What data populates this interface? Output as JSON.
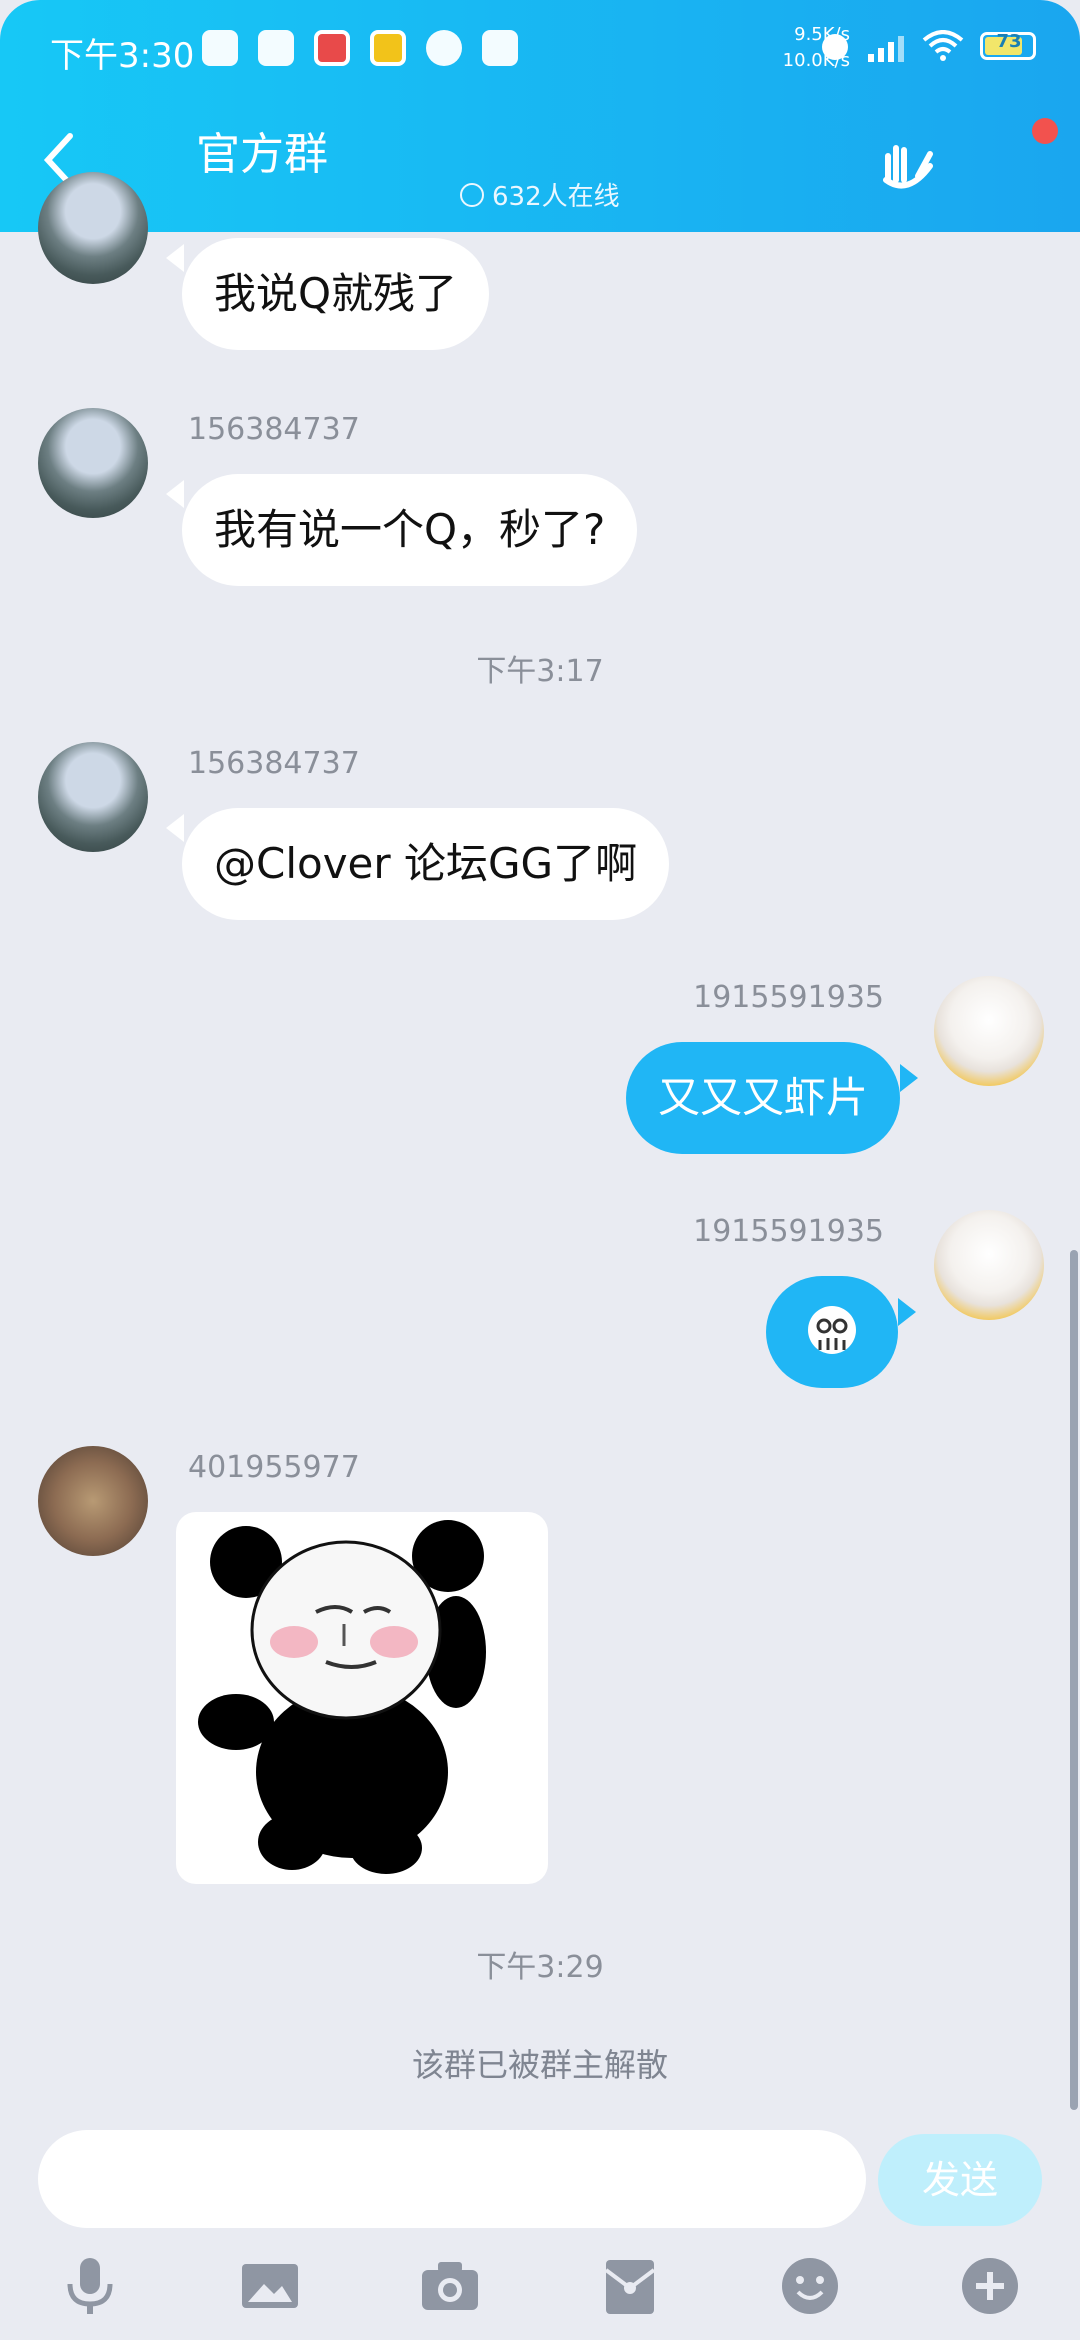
{
  "status_bar": {
    "time": "下午3:30",
    "net_speed_up": "9.5K/s",
    "net_speed_down": "10.0K/s",
    "battery": "73"
  },
  "header": {
    "title": "官方群",
    "online": "632人在线"
  },
  "messages": [
    {
      "sender": "",
      "text": "我说Q就残了"
    },
    {
      "sender": "156384737",
      "text": "我有说一个Q，秒了?"
    },
    {
      "time": "下午3:17"
    },
    {
      "sender": "156384737",
      "text": "@Clover 论坛GG了啊"
    },
    {
      "sender": "1915591935",
      "text": "又又又虾片"
    },
    {
      "sender": "1915591935",
      "text": ""
    },
    {
      "sender": "401955977",
      "text": ""
    },
    {
      "time": "下午3:29"
    },
    {
      "system": "该群已被群主解散"
    }
  ],
  "input": {
    "placeholder": "",
    "send_label": "发送"
  },
  "toolbar": {
    "icons": [
      "microphone-icon",
      "image-icon",
      "camera-icon",
      "red-packet-icon",
      "emoji-icon",
      "plus-icon"
    ]
  },
  "colors": {
    "header_start": "#17c8f6",
    "header_end": "#1aa6ef",
    "mine_bubble": "#20b6f5",
    "chat_bg": "#e9ebf2"
  }
}
